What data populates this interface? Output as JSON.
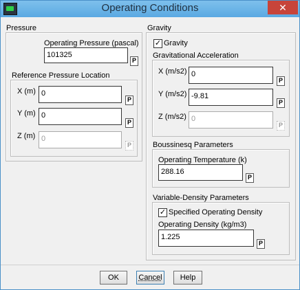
{
  "window": {
    "title": "Operating Conditions",
    "close_label": "✕"
  },
  "pressure": {
    "group_label": "Pressure",
    "operating_pressure_label": "Operating Pressure (pascal)",
    "operating_pressure_value": "101325",
    "ref_location_label": "Reference Pressure Location",
    "x_label": "X (m)",
    "x_value": "0",
    "y_label": "Y (m)",
    "y_value": "0",
    "z_label": "Z (m)",
    "z_value": "0"
  },
  "gravity": {
    "group_label": "Gravity",
    "checkbox_label": "Gravity",
    "checked": true,
    "accel_label": "Gravitational Acceleration",
    "x_label": "X (m/s2)",
    "x_value": "0",
    "y_label": "Y (m/s2)",
    "y_value": "-9.81",
    "z_label": "Z (m/s2)",
    "z_value": "0"
  },
  "boussinesq": {
    "group_label": "Boussinesq Parameters",
    "temp_label": "Operating Temperature (k)",
    "temp_value": "288.16"
  },
  "variable_density": {
    "group_label": "Variable-Density Parameters",
    "checkbox_label": "Specified Operating Density",
    "checked": true,
    "density_label": "Operating Density (kg/m3)",
    "density_value": "1.225"
  },
  "param_button_label": "P",
  "check_mark": "✓",
  "buttons": {
    "ok": "OK",
    "cancel": "Cancel",
    "help": "Help"
  }
}
